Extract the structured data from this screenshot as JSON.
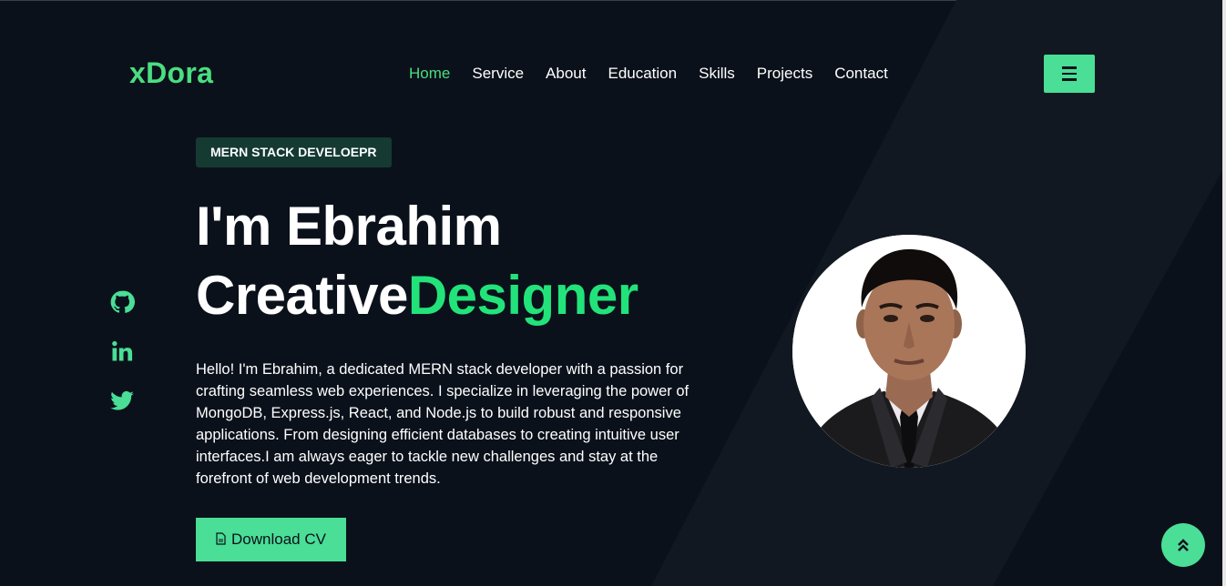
{
  "brand": {
    "logo": "xDora"
  },
  "nav": {
    "items": [
      {
        "label": "Home",
        "active": true
      },
      {
        "label": "Service"
      },
      {
        "label": "About"
      },
      {
        "label": "Education"
      },
      {
        "label": "Skills"
      },
      {
        "label": "Projects"
      },
      {
        "label": "Contact"
      }
    ],
    "menu_icon": "hamburger-icon"
  },
  "hero": {
    "badge": "MERN STACK DEVELOEPR",
    "title_line1": "I'm Ebrahim",
    "title_line2_plain": "Creative",
    "title_line2_accent": "Designer",
    "bio": "Hello! I'm Ebrahim, a dedicated MERN stack developer with a passion for crafting seamless web experiences. I specialize in leveraging the power of MongoDB, Express.js, React, and Node.js to build robust and responsive applications. From designing efficient databases to creating intuitive user interfaces.I am always eager to tackle new challenges and stay at the forefront of web development trends.",
    "cv_button": "Download CV",
    "cv_icon": "file-icon"
  },
  "social": [
    "github-icon",
    "linkedin-icon",
    "twitter-icon"
  ],
  "scroll_top_icon": "double-chevron-up-icon",
  "colors": {
    "background": "#0b111b",
    "accent": "#4ade96",
    "accent_text": "#22e37a",
    "badge_bg": "#143a32"
  }
}
